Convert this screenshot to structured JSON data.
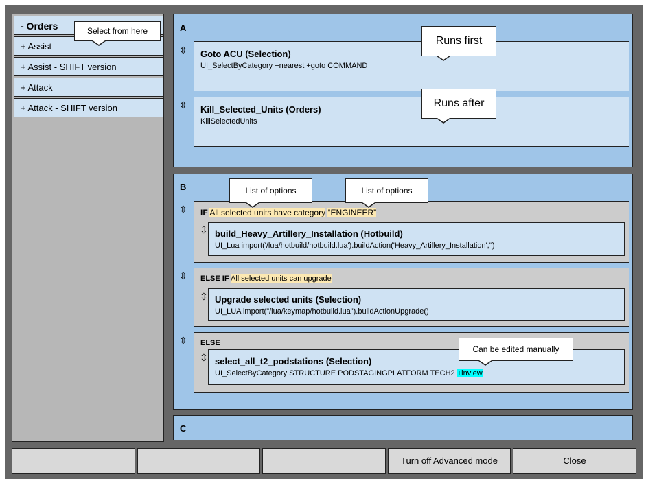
{
  "left_menu": {
    "header": "-  Orders",
    "items": [
      "+  Assist",
      "+  Assist - SHIFT version",
      "+  Attack",
      "+  Attack - SHIFT version"
    ]
  },
  "callouts": {
    "select_from_here": "Select from here",
    "runs_first": "Runs first",
    "runs_after": "Runs after",
    "list_of_options_1": "List of options",
    "list_of_options_2": "List of options",
    "can_be_edited": "Can be edited manually"
  },
  "handle_icon": "⇳",
  "section_a": {
    "label": "A",
    "entries": [
      {
        "title": "Goto ACU (Selection)",
        "command": "UI_SelectByCategory +nearest +goto COMMAND"
      },
      {
        "title": "Kill_Selected_Units (Orders)",
        "command": "KillSelectedUnits"
      }
    ]
  },
  "section_b": {
    "label": "B",
    "if": {
      "keyword": "IF",
      "condition": "All selected units have category",
      "value": "“ENGINEER”",
      "entry": {
        "title": "build_Heavy_Artillery_Installation (Hotbuild)",
        "command": "UI_Lua import('/lua/hotbuild/hotbuild.lua').buildAction('Heavy_Artillery_Installation','')"
      }
    },
    "else_if": {
      "keyword": "ELSE IF",
      "condition": "All selected units can upgrade",
      "entry": {
        "title": "Upgrade selected units (Selection)",
        "command": "UI_LUA import(\"/lua/keymap/hotbuild.lua\").buildActionUpgrade()"
      }
    },
    "else": {
      "keyword": "ELSE",
      "entry": {
        "title": "select_all_t2_podstations (Selection)",
        "command": "UI_SelectByCategory STRUCTURE PODSTAGINGPLATFORM TECH2",
        "command_highlight": "+inview"
      }
    }
  },
  "section_c": {
    "label": "C"
  },
  "buttons": [
    "",
    "",
    "",
    "Turn off Advanced mode",
    "Close"
  ],
  "colors": {
    "frame": "#666666",
    "panel_bg": "#b7b7b7",
    "section_bg": "#9fc5e8",
    "entry_bg": "#cfe2f3",
    "condition_bg": "#cccccc",
    "highlight_yellow": "#fce8b2",
    "highlight_cyan": "#00ffff"
  }
}
